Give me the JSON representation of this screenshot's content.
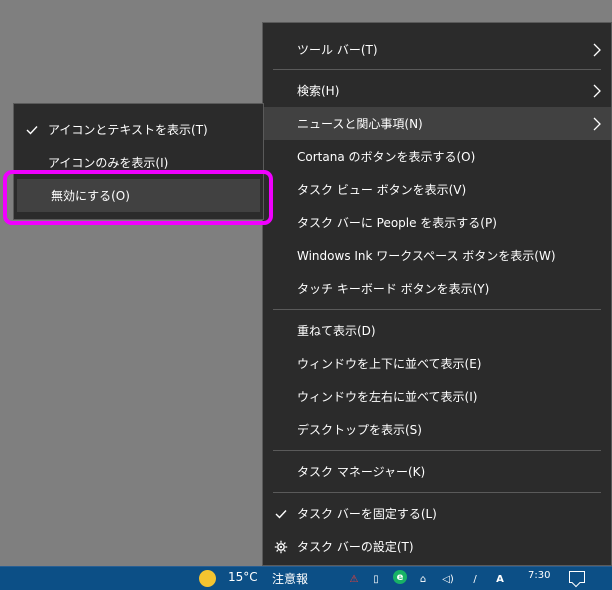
{
  "main_menu": {
    "items": [
      {
        "label": "ツール バー(T)"
      },
      {
        "label": "検索(H)"
      },
      {
        "label": "ニュースと関心事項(N)"
      },
      {
        "label": "Cortana のボタンを表示する(O)"
      },
      {
        "label": "タスク ビュー ボタンを表示(V)"
      },
      {
        "label": "タスク バーに People を表示する(P)"
      },
      {
        "label": "Windows Ink ワークスペース ボタンを表示(W)"
      },
      {
        "label": "タッチ キーボード ボタンを表示(Y)"
      },
      {
        "label": "重ねて表示(D)"
      },
      {
        "label": "ウィンドウを上下に並べて表示(E)"
      },
      {
        "label": "ウィンドウを左右に並べて表示(I)"
      },
      {
        "label": "デスクトップを表示(S)"
      },
      {
        "label": "タスク マネージャー(K)"
      },
      {
        "label": "タスク バーを固定する(L)"
      },
      {
        "label": "タスク バーの設定(T)"
      }
    ]
  },
  "submenu": {
    "items": [
      {
        "label": "アイコンとテキストを表示(T)"
      },
      {
        "label": "アイコンのみを表示(I)"
      },
      {
        "label": "無効にする(O)"
      }
    ]
  },
  "taskbar": {
    "temperature": "15°C",
    "weather_status": "注意報",
    "clock": "7:30",
    "tray_e": "e",
    "tray_ime": "A",
    "tray_red": "⚠",
    "tray_doc": "▯",
    "tray_net": "⌂",
    "tray_speaker": "◁)",
    "tray_pen": "/"
  },
  "colors": {
    "desktop": "#7f7f7f",
    "menu_background": "#2b2b2b",
    "menu_border": "#5a5a5a",
    "hover_background": "#414141",
    "highlight_ring": "#f000ff",
    "taskbar": "#0c4f86"
  }
}
